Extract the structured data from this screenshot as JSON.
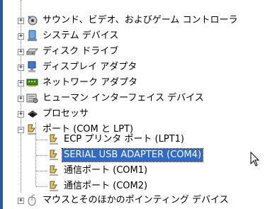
{
  "tree": {
    "categories": [
      {
        "label": "サウンド、ビデオ、およびゲーム コントローラ",
        "icon": "sound-icon",
        "expander": "+"
      },
      {
        "label": "システム デバイス",
        "icon": "system-device-icon",
        "expander": "+"
      },
      {
        "label": "ディスク ドライブ",
        "icon": "disk-drive-icon",
        "expander": "+"
      },
      {
        "label": "ディスプレイ アダプタ",
        "icon": "display-adapter-icon",
        "expander": "+"
      },
      {
        "label": "ネットワーク アダプタ",
        "icon": "network-adapter-icon",
        "expander": "+"
      },
      {
        "label": "ヒューマン インターフェイス デバイス",
        "icon": "hid-icon",
        "expander": "+"
      },
      {
        "label": "プロセッサ",
        "icon": "processor-icon",
        "expander": "+"
      },
      {
        "label": "ポート (COM と LPT)",
        "icon": "port-icon",
        "expander": "−"
      },
      {
        "label": "マウスとそのほかのポインティング デバイス",
        "icon": "mouse-icon",
        "expander": "+"
      }
    ],
    "ports": [
      {
        "label": "ECP プリンタ ポート (LPT1)",
        "icon": "port-icon",
        "selected": false
      },
      {
        "label": "SERIAL USB ADAPTER (COM4)",
        "icon": "port-icon",
        "selected": true
      },
      {
        "label": "通信ポート (COM1)",
        "icon": "port-icon",
        "selected": false
      },
      {
        "label": "通信ポート (COM2)",
        "icon": "port-icon",
        "selected": false
      }
    ],
    "selection_color": "#316ac5"
  },
  "cursor": {
    "icon": "arrow-cursor-icon"
  }
}
